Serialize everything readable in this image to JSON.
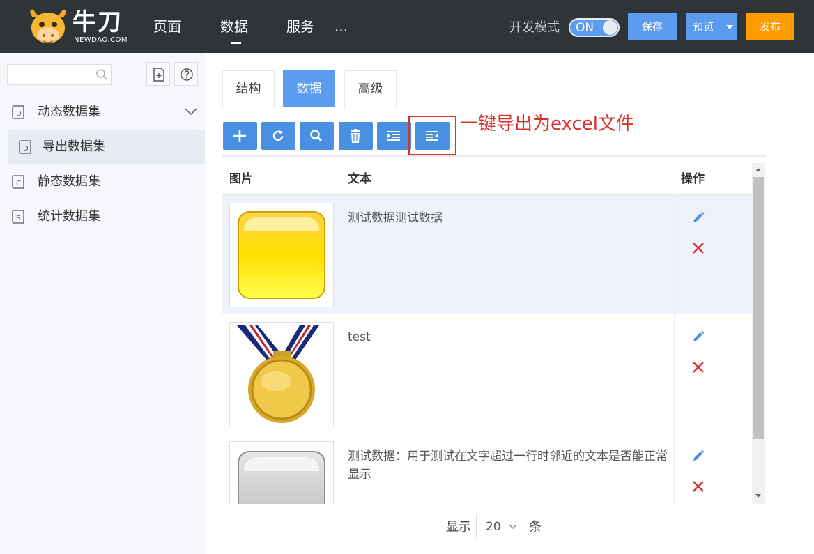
{
  "logo": {
    "text": "牛刀",
    "subtext": "NEWDAO.COM"
  },
  "nav": {
    "items": [
      "页面",
      "数据",
      "服务",
      "..."
    ],
    "active": "数据"
  },
  "header": {
    "dev_mode_label": "开发模式",
    "toggle_label": "ON",
    "save_label": "保存",
    "preview_label": "预览",
    "publish_label": "发布"
  },
  "colors": {
    "accent": "#5b9bf0",
    "publish": "#ff9d00",
    "topbar": "#2f3438",
    "annotation": "#d9312b",
    "delete": "#d9312b"
  },
  "sidebar": {
    "search": {
      "value": "",
      "placeholder": ""
    },
    "items": [
      {
        "label": "动态数据集",
        "icon": "dataset-d-icon",
        "expanded": true
      },
      {
        "label": "导出数据集",
        "icon": "dataset-d-icon",
        "selected": true
      },
      {
        "label": "静态数据集",
        "icon": "dataset-c-icon"
      },
      {
        "label": "统计数据集",
        "icon": "dataset-s-icon"
      }
    ]
  },
  "tabs": [
    {
      "label": "结构"
    },
    {
      "label": "数据",
      "active": true
    },
    {
      "label": "高级"
    }
  ],
  "toolbar": {
    "buttons": [
      "add-icon",
      "refresh-icon",
      "search-icon",
      "trash-icon",
      "import-icon",
      "export-icon"
    ],
    "annotation": "一键导出为excel文件"
  },
  "table": {
    "headers": [
      "图片",
      "文本",
      "操作"
    ],
    "rows": [
      {
        "image": "yellow-square-image",
        "text": "测试数据测试数据"
      },
      {
        "image": "gold-medal-image",
        "text": "test"
      },
      {
        "image": "gray-square-image",
        "text": "测试数据：用于测试在文字超过一行时邻近的文本是否能正常显示"
      }
    ]
  },
  "pager": {
    "prefix": "显示",
    "page_size": "20",
    "suffix": "条"
  }
}
